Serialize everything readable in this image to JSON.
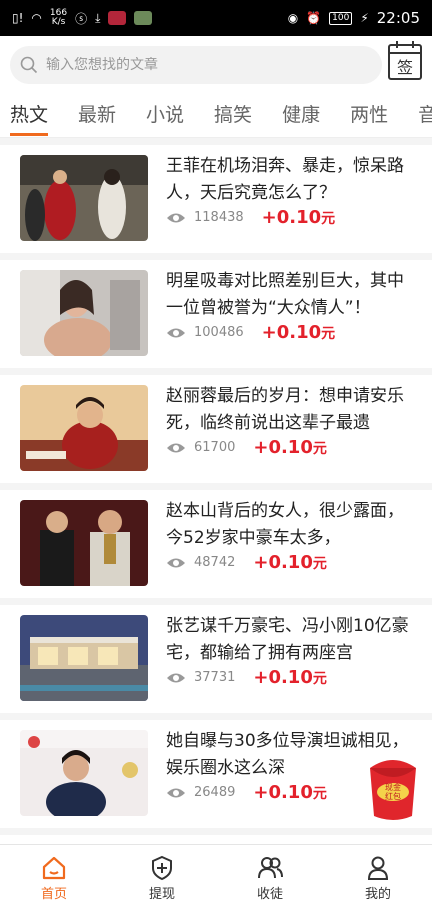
{
  "status": {
    "speed_top": "166",
    "speed_bottom": "K/s",
    "battery": "100",
    "time": "22:05"
  },
  "search": {
    "placeholder": "输入您想找的文章",
    "sign_label": "签"
  },
  "tabs": [
    "热文",
    "最新",
    "小说",
    "搞笑",
    "健康",
    "两性",
    "音"
  ],
  "articles": [
    {
      "title": "王菲在机场泪奔、暴走，惊呆路人，天后究竟怎么了？",
      "views": "118438",
      "reward": "+0.10",
      "unit": "元"
    },
    {
      "title": "明星吸毒对比照差别巨大，其中一位曾被誉为“大众情人”！",
      "views": "100486",
      "reward": "+0.10",
      "unit": "元"
    },
    {
      "title": "赵丽蓉最后的岁月：想申请安乐死，临终前说出这辈子最遗",
      "views": "61700",
      "reward": "+0.10",
      "unit": "元"
    },
    {
      "title": "赵本山背后的女人，很少露面，今52岁家中豪车太多，",
      "views": "48742",
      "reward": "+0.10",
      "unit": "元"
    },
    {
      "title": "张艺谋千万豪宅、冯小刚10亿豪宅，都输给了拥有两座宫",
      "views": "37731",
      "reward": "+0.10",
      "unit": "元"
    },
    {
      "title": "她自曝与30多位导演坦诚相见，娱乐圈水这么深",
      "views": "26489",
      "reward": "+0.10",
      "unit": "元"
    }
  ],
  "redpacket": {
    "label_line1": "现金",
    "label_line2": "红包"
  },
  "nav": [
    {
      "label": "首页",
      "icon": "home-icon"
    },
    {
      "label": "提现",
      "icon": "shield-plus-icon"
    },
    {
      "label": "收徒",
      "icon": "people-icon"
    },
    {
      "label": "我的",
      "icon": "user-icon"
    }
  ],
  "colors": {
    "accent": "#f06a1e",
    "reward": "#e3212b"
  }
}
